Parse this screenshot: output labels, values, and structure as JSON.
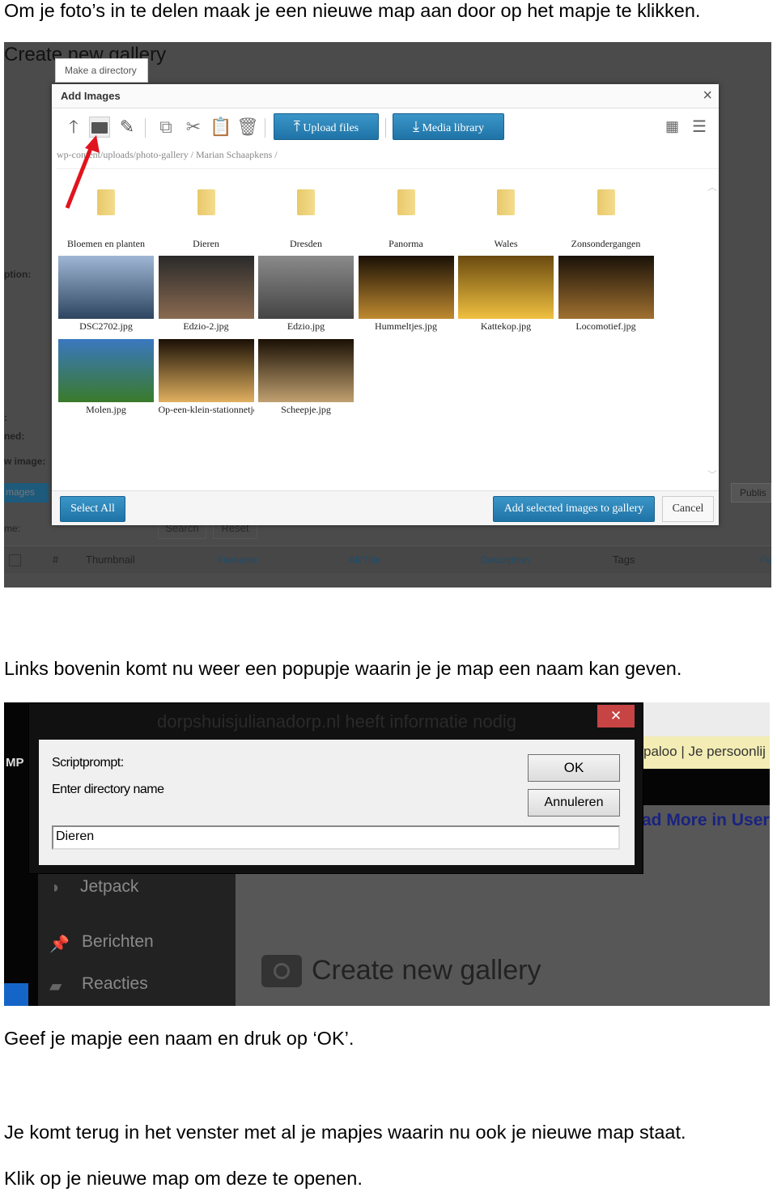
{
  "paragraphs": {
    "p1": "Om je foto’s in te delen maak je een nieuwe map aan door op het mapje te klikken.",
    "p2": "Links bovenin komt nu weer een popupje waarin je je map een naam kan geven.",
    "p3": "Geef je mapje een naam en druk op ‘OK’.",
    "p4": "Je komt terug in het venster met al je mapjes waarin nu ook je nieuwe map staat.",
    "p5": "Klik op je nieuwe map om deze te openen."
  },
  "shot1": {
    "page_title": "Create new gallery",
    "tooltip": "Make a directory",
    "background_labels": [
      "ption:",
      ":",
      "ned:",
      "w image:",
      "me:"
    ],
    "background_buttons": {
      "images": "mages",
      "publish": "Publis",
      "search": "Search",
      "reset": "Reset"
    },
    "table_headers": [
      "#",
      "Thumbnail",
      "Filename",
      "Alt/Title",
      "Description",
      "Tags",
      "Pu"
    ],
    "dialog": {
      "title": "Add Images",
      "close": "×",
      "toolbar_icons": [
        "arrow-up-icon",
        "new-folder-icon",
        "edit-icon",
        "copy-icon",
        "cut-icon",
        "paste-icon",
        "trash-icon"
      ],
      "upload_label": "Upload files",
      "media_label": "Media library",
      "breadcrumb": "wp-content/uploads/photo-gallery / Marian Schaapkens /",
      "folders": [
        "Bloemen en planten",
        "Dieren",
        "Dresden",
        "Panorma",
        "Wales",
        "Zonsondergangen"
      ],
      "images": [
        {
          "name": "DSC2702.jpg",
          "colors": [
            "#9fb7d4",
            "#2d4560"
          ]
        },
        {
          "name": "Edzio-2.jpg",
          "colors": [
            "#2a2a2a",
            "#8a6a50"
          ]
        },
        {
          "name": "Edzio.jpg",
          "colors": [
            "#8a8a8a",
            "#444"
          ]
        },
        {
          "name": "Hummeltjes.jpg",
          "colors": [
            "#1a1005",
            "#c08a30"
          ]
        },
        {
          "name": "Kattekop.jpg",
          "colors": [
            "#6a4a10",
            "#f0c040"
          ]
        },
        {
          "name": "Locomotief.jpg",
          "colors": [
            "#1a1208",
            "#a07030"
          ]
        },
        {
          "name": "Molen.jpg",
          "colors": [
            "#3a78c0",
            "#3a7a2a"
          ]
        },
        {
          "name": "Op-een-klein-stationnetje.jpg",
          "colors": [
            "#1a1005",
            "#e0b060"
          ]
        },
        {
          "name": "Scheepje.jpg",
          "colors": [
            "#1a1005",
            "#c0a070"
          ]
        }
      ],
      "select_all": "Select All",
      "add_selected": "Add selected images to gallery",
      "cancel": "Cancel"
    },
    "accent": "#2a82b8",
    "arrow_color": "#e0141e"
  },
  "shot2": {
    "dialog_title": "dorpshuisjulianadorp.nl heeft informatie nodig",
    "close": "✕",
    "label1": "Scriptprompt:",
    "label2": "Enter directory name",
    "input_value": "Dieren",
    "ok": "OK",
    "cancel": "Annuleren",
    "left_fragment": "MP",
    "tab_fragment": "paloo | Je persoonlij",
    "link_fragment": "ad More in User",
    "sidebar": [
      "Jetpack",
      "Berichten",
      "Reacties"
    ],
    "page_title": "Create new gallery"
  }
}
